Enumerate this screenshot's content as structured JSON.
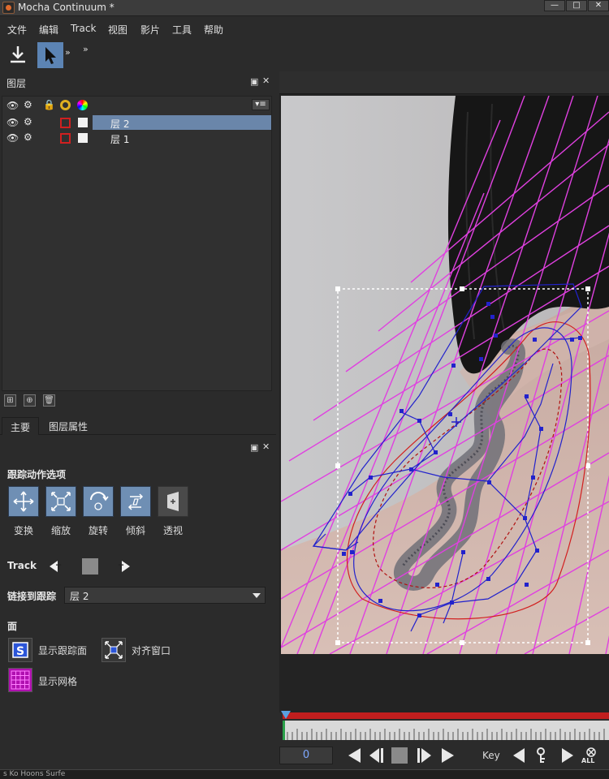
{
  "window": {
    "title": "Mocha Continuum *",
    "min_label": "—",
    "max_label": "□"
  },
  "menu": [
    "文件",
    "编辑",
    "Track",
    "视图",
    "影片",
    "工具",
    "帮助"
  ],
  "toolbar": {
    "more_1": "»",
    "more_2": "»"
  },
  "layers_panel": {
    "title": "图层",
    "layers": [
      {
        "name": "层 2",
        "selected": true
      },
      {
        "name": "层 1",
        "selected": false
      }
    ]
  },
  "tabs": [
    {
      "label": "主要",
      "active": true
    },
    {
      "label": "图层属性",
      "active": false
    }
  ],
  "motion": {
    "title": "跟踪动作选项",
    "options": [
      {
        "label": "变换",
        "enabled": true
      },
      {
        "label": "缩放",
        "enabled": true
      },
      {
        "label": "旋转",
        "enabled": true
      },
      {
        "label": "倾斜",
        "enabled": true
      },
      {
        "label": "透视",
        "enabled": false
      }
    ]
  },
  "track": {
    "label": "Track"
  },
  "link": {
    "label": "链接到跟踪",
    "value": "层 2"
  },
  "surface": {
    "title": "面",
    "show_surface": "显示跟踪面",
    "align_window": "对齐窗口",
    "show_grid": "显示网格"
  },
  "transport": {
    "frame": "0",
    "key_label": "Key",
    "all_label": "ALL"
  },
  "bottom": {
    "text": "s  Ko Hoons Surfe"
  },
  "colors": {
    "accent": "#6f8fb4",
    "selection": "#6a86aa",
    "grid": "#e040e0",
    "spline_blue": "#2222cc",
    "spline_red": "#d22020"
  }
}
